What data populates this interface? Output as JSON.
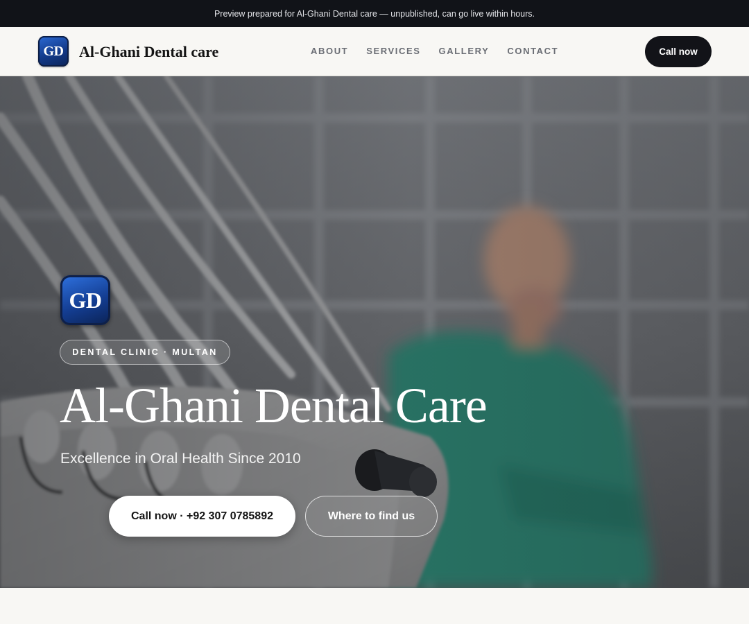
{
  "banner": {
    "text": "Preview prepared for Al-Ghani Dental care — unpublished, can go live within hours."
  },
  "nav": {
    "logo_text": "GD",
    "brand": "Al-Ghani Dental care",
    "links": [
      "ABOUT",
      "SERVICES",
      "GALLERY",
      "CONTACT"
    ],
    "cta": "Call now"
  },
  "hero": {
    "logo_text": "GD",
    "eyebrow": "DENTAL CLINIC · MULTAN",
    "title": "Al-Ghani Dental Care",
    "subtitle": "Excellence in Oral Health Since 2010",
    "primary_button": "Call now · +92 307 0785892",
    "secondary_button": "Where to find us"
  },
  "colors": {
    "banner_bg": "#111318",
    "nav_bg": "#f8f7f4",
    "cta_bg": "#121318",
    "logo_blue": "#1a4db0",
    "scrubs_teal": "#2f8f7a"
  }
}
